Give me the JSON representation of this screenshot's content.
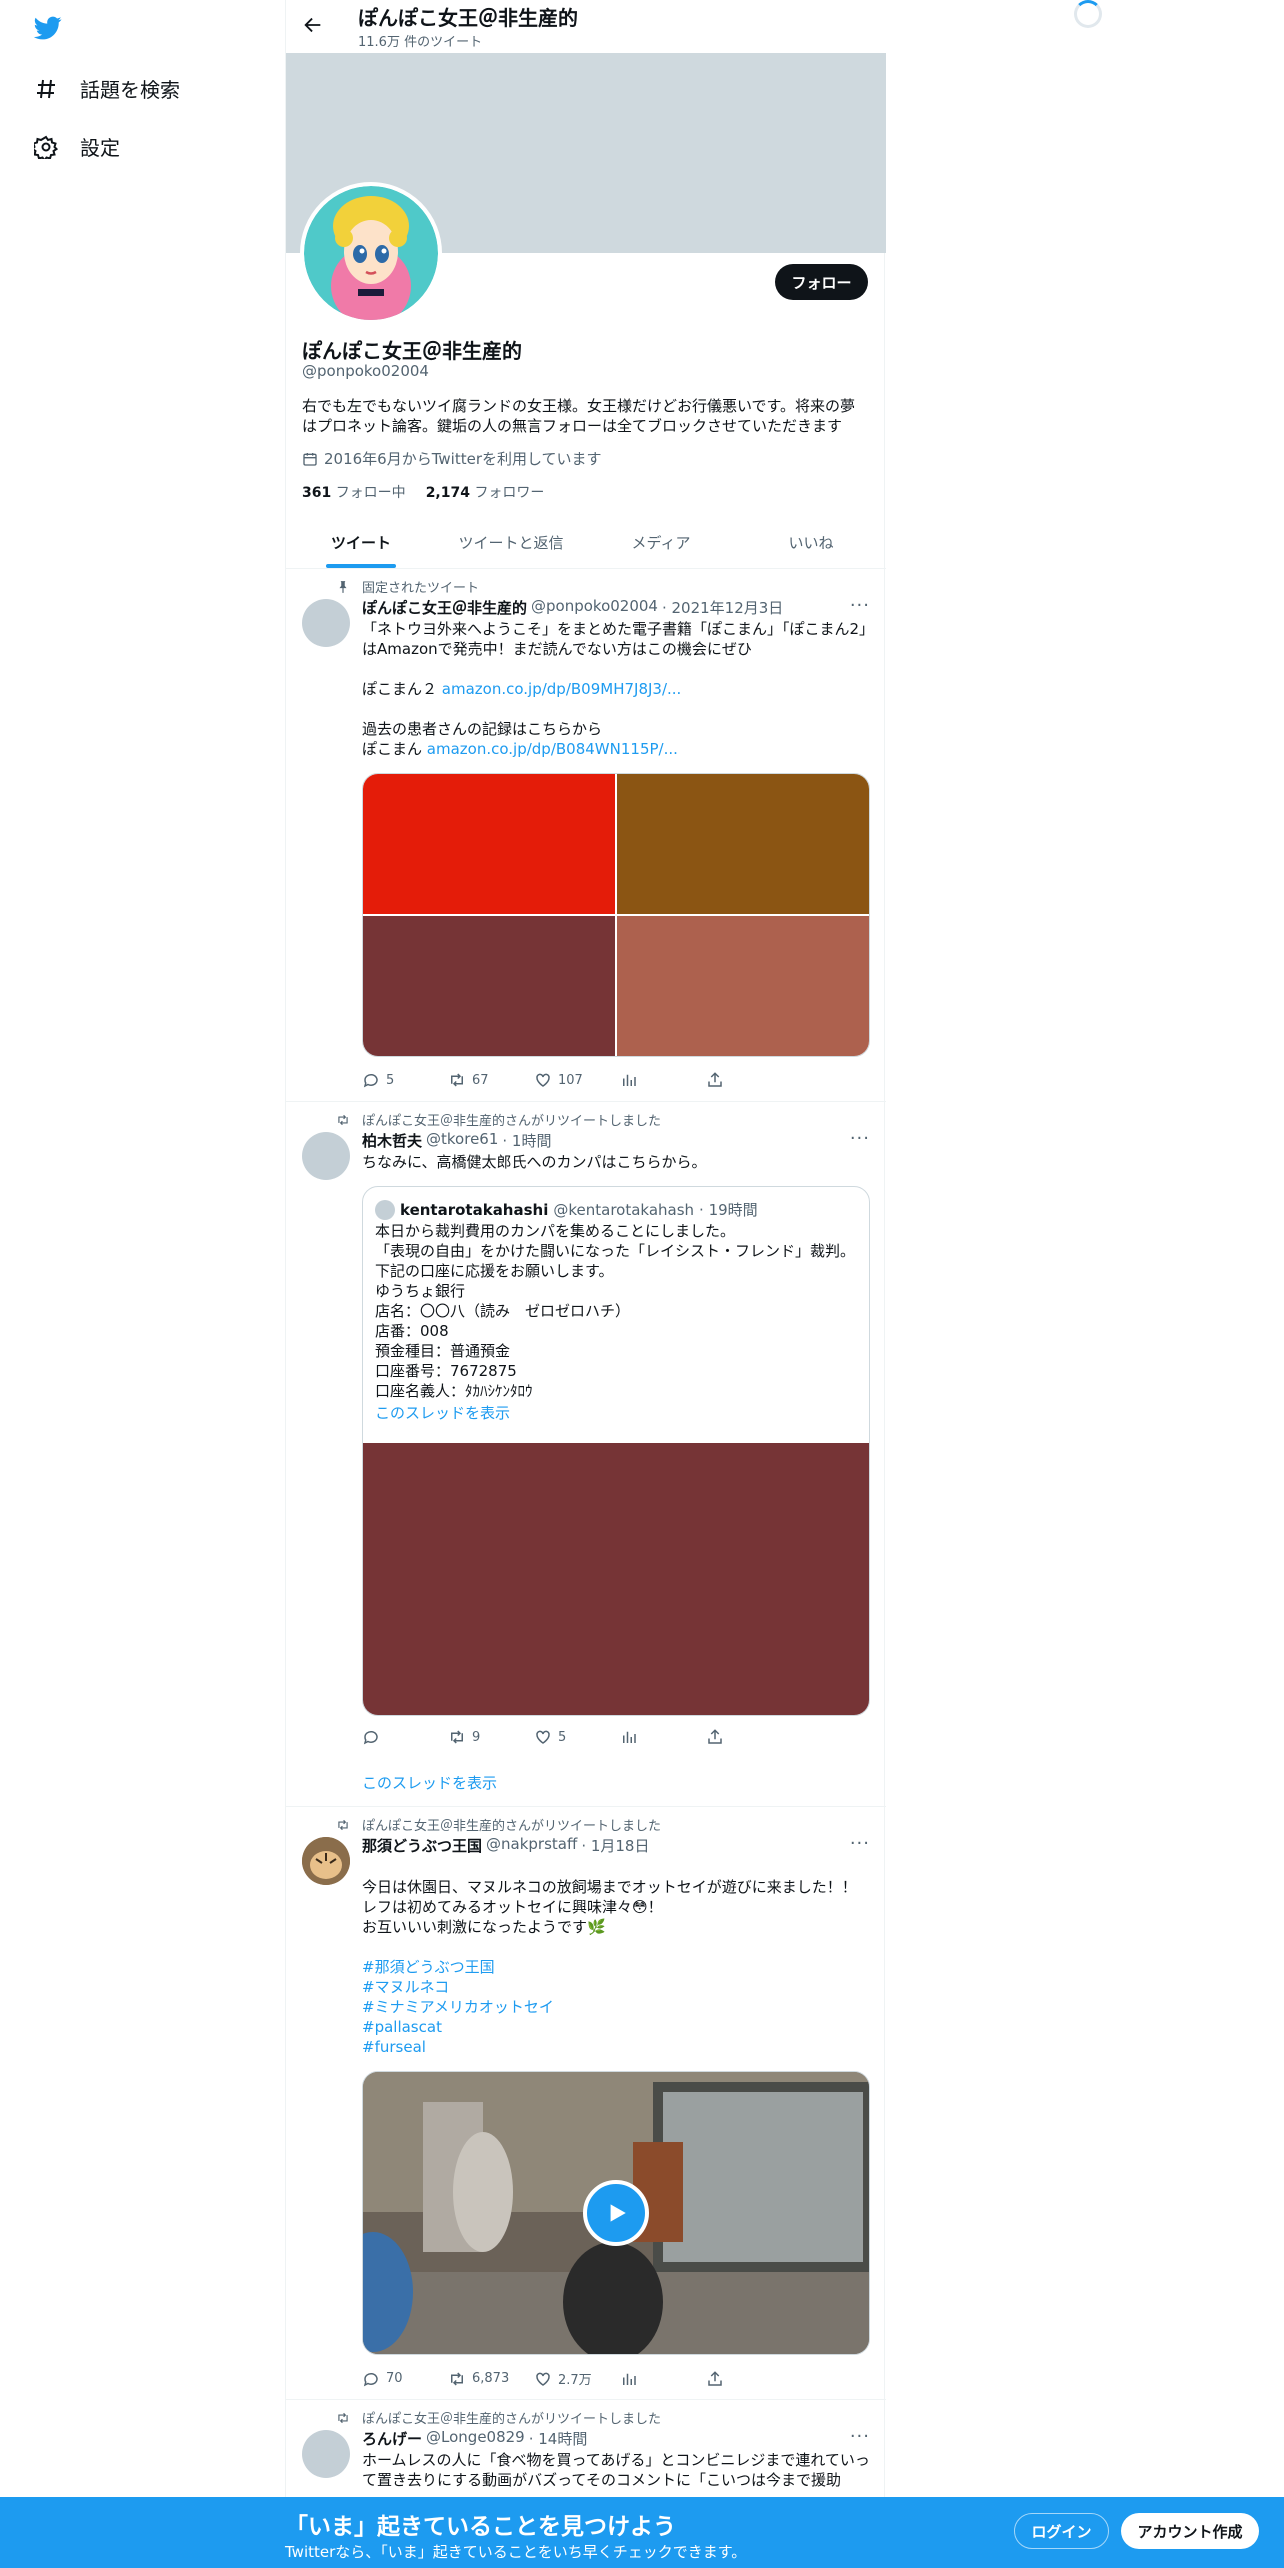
{
  "nav": {
    "explore_label": "話題を検索",
    "settings_label": "設定"
  },
  "header": {
    "title": "ぽんぽこ女王＠非生産的",
    "tweet_count": "11.6万 件のツイート"
  },
  "profile": {
    "follow_label": "フォロー",
    "name": "ぽんぽこ女王＠非生産的",
    "handle": "@ponpoko02004",
    "bio": "右でも左でもないツイ腐ランドの女王様。女王様だけどお行儀悪いです。将来の夢はプロネット論客。鍵垢の人の無言フォローは全てブロックさせていただきます",
    "joined": "2016年6月からTwitterを利用しています",
    "following_count": "361",
    "following_label": "フォロー中",
    "followers_count": "2,174",
    "followers_label": "フォロワー"
  },
  "tabs": [
    "ツイート",
    "ツイートと返信",
    "メディア",
    "いいね"
  ],
  "tweets": [
    {
      "context": "固定されたツイート",
      "name": "ぽんぽこ女王＠非生産的",
      "handle": "@ponpoko02004",
      "time": "· 2021年12月3日",
      "text_1": "「ネトウヨ外来へようこそ」をまとめた電子書籍「ぽこまん」「ぽこまん2」はAmazonで発売中！まだ読んでない方はこの機会にぜひ",
      "text_2": "ぽこまん２",
      "link_1": "amazon.co.jp/dp/B09MH7J8J3/...",
      "text_3": "過去の患者さんの記録はこちらから",
      "text_4": "ぽこまん",
      "link_2": "amazon.co.jp/dp/B084WN115P/...",
      "media_colors": [
        "#e41c09",
        "#8b5513",
        "#763436",
        "#ad614e"
      ],
      "replies": "5",
      "retweets": "67",
      "likes": "107"
    },
    {
      "context": "ぽんぽこ女王＠非生産的さんがリツイートしました",
      "name": "柏木哲夫",
      "handle": "@tkore61",
      "time": "· 1時間",
      "text": "ちなみに、高橋健太郎氏へのカンパはこちらから。",
      "quote": {
        "name": "kentarotakahashi",
        "handle": "@kentarotakahash",
        "time": "· 19時間",
        "text": "本日から裁判費用のカンパを集めることにしました。\n「表現の自由」をかけた闘いになった「レイシスト・フレンド」裁判。下記の口座に応援をお願いします。\nゆうちょ銀行\n店名：〇〇八（読み　ゼロゼロハチ）\n店番：008\n預金種目：普通預金\n口座番号：7672875\n口座名義人：ﾀｶﾊｼｹﾝﾀﾛｳ",
        "thread_label": "このスレッドを表示",
        "media_color": "#763436"
      },
      "replies": "",
      "retweets": "9",
      "likes": "5",
      "thread_label": "このスレッドを表示"
    },
    {
      "context": "ぽんぽこ女王＠非生産的さんがリツイートしました",
      "name": "那須どうぶつ王国",
      "handle": "@nakprstaff",
      "time": "· 1月18日",
      "text": "今日は休園日、マヌルネコの放飼場までオットセイが遊びに来ました！！\nレフは初めてみるオットセイに興味津々😳！\nお互いいい刺激になったようです🌿",
      "hashtags": [
        "#那須どうぶつ王国",
        "#マヌルネコ",
        "#ミナミアメリカオットセイ",
        "#pallascat",
        "#furseal"
      ],
      "replies": "70",
      "retweets": "6,873",
      "likes": "2.7万"
    },
    {
      "context": "ぽんぽこ女王＠非生産的さんがリツイートしました",
      "name": "ろんげー",
      "handle": "@Longe0829",
      "time": "· 14時間",
      "text": "ホームレスの人に「食べ物を買ってあげる」とコンビニレジまで連れていって置き去りにする動画がバズってそのコメントに「こいつは今まで援助"
    }
  ],
  "bottom_bar": {
    "title": "「いま」起きていることを見つけよう",
    "subtitle": "Twitterなら、「いま」起きていることをいち早くチェックできます。",
    "login_label": "ログイン",
    "signup_label": "アカウント作成"
  },
  "colors": {
    "accent": "#1d9bf0",
    "banner": "#cfd9de",
    "text_secondary": "#536471"
  }
}
